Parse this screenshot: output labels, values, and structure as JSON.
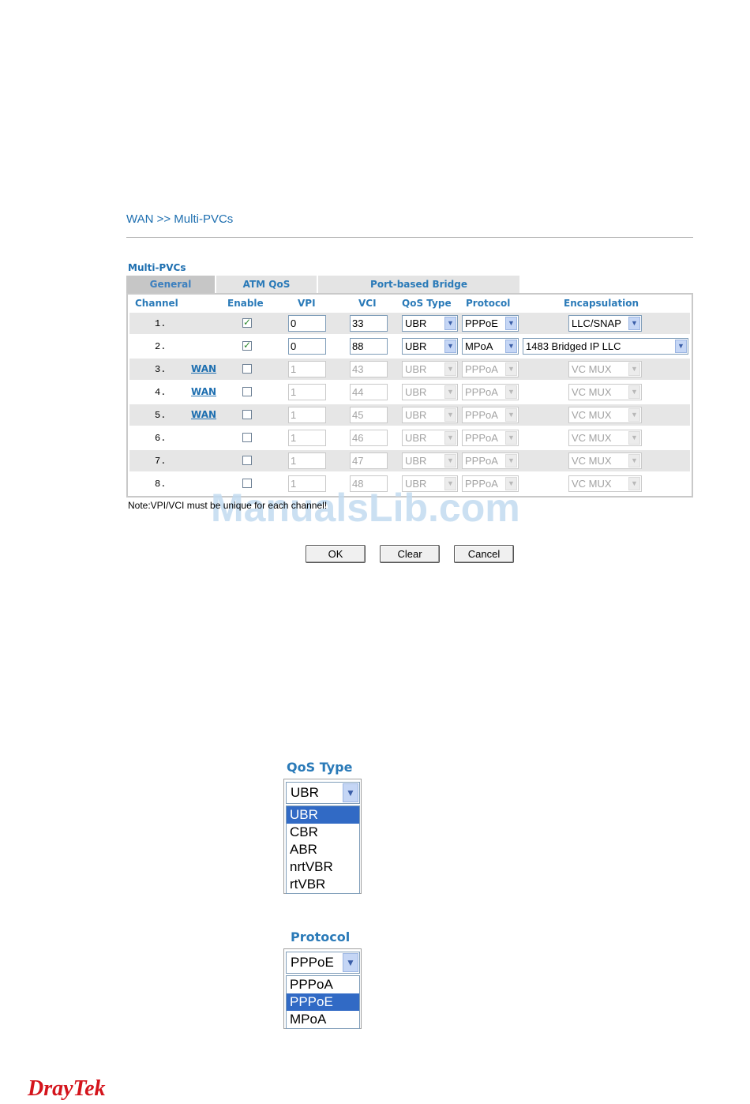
{
  "breadcrumb": "WAN >> Multi-PVCs",
  "section_title": "Multi-PVCs",
  "tabs": [
    {
      "label": "General",
      "active": true
    },
    {
      "label": "ATM QoS",
      "active": false
    },
    {
      "label": "Port-based Bridge",
      "active": false
    }
  ],
  "headers": {
    "channel": "Channel",
    "enable": "Enable",
    "vpi": "VPI",
    "vci": "VCI",
    "qos": "QoS Type",
    "protocol": "Protocol",
    "encap": "Encapsulation"
  },
  "rows": [
    {
      "channel": "1.",
      "wan": "",
      "enabled": true,
      "disabled": false,
      "vpi": "0",
      "vci": "33",
      "qos": "UBR",
      "protocol": "PPPoE",
      "encap": "LLC/SNAP"
    },
    {
      "channel": "2.",
      "wan": "",
      "enabled": true,
      "disabled": false,
      "vpi": "0",
      "vci": "88",
      "qos": "UBR",
      "protocol": "MPoA",
      "encap": "1483 Bridged IP LLC"
    },
    {
      "channel": "3.",
      "wan": "WAN",
      "enabled": false,
      "disabled": true,
      "vpi": "1",
      "vci": "43",
      "qos": "UBR",
      "protocol": "PPPoA",
      "encap": "VC MUX"
    },
    {
      "channel": "4.",
      "wan": "WAN",
      "enabled": false,
      "disabled": true,
      "vpi": "1",
      "vci": "44",
      "qos": "UBR",
      "protocol": "PPPoA",
      "encap": "VC MUX"
    },
    {
      "channel": "5.",
      "wan": "WAN",
      "enabled": false,
      "disabled": true,
      "vpi": "1",
      "vci": "45",
      "qos": "UBR",
      "protocol": "PPPoA",
      "encap": "VC MUX"
    },
    {
      "channel": "6.",
      "wan": "",
      "enabled": false,
      "disabled": true,
      "vpi": "1",
      "vci": "46",
      "qos": "UBR",
      "protocol": "PPPoA",
      "encap": "VC MUX"
    },
    {
      "channel": "7.",
      "wan": "",
      "enabled": false,
      "disabled": true,
      "vpi": "1",
      "vci": "47",
      "qos": "UBR",
      "protocol": "PPPoA",
      "encap": "VC MUX"
    },
    {
      "channel": "8.",
      "wan": "",
      "enabled": false,
      "disabled": true,
      "vpi": "1",
      "vci": "48",
      "qos": "UBR",
      "protocol": "PPPoA",
      "encap": "VC MUX"
    }
  ],
  "note": "Note:VPI/VCI must be unique for each channel!",
  "watermark": "ManualsLib.com",
  "buttons": {
    "ok": "OK",
    "clear": "Clear",
    "cancel": "Cancel"
  },
  "qos_dropdown": {
    "title": "QoS Type",
    "selected": "UBR",
    "options": [
      "UBR",
      "CBR",
      "ABR",
      "nrtVBR",
      "rtVBR"
    ],
    "highlighted": "UBR"
  },
  "protocol_dropdown": {
    "title": "Protocol",
    "selected": "PPPoE",
    "options": [
      "PPPoA",
      "PPPoE",
      "MPoA"
    ],
    "highlighted": "PPPoE"
  },
  "logo": "DrayTek",
  "colors": {
    "heading": "#2a7ab8",
    "highlight": "#316ac5",
    "logo": "#d4141c",
    "row_shade": "#e6e6e6"
  }
}
